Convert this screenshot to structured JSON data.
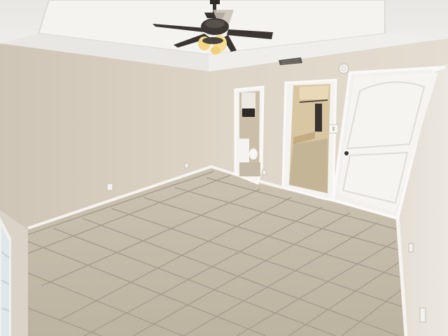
{
  "scene": {
    "kind": "empty bedroom interior photo",
    "elements": [
      "ceiling-fan",
      "recessed-tray-ceiling",
      "hvac-vent",
      "smoke-detector",
      "bathroom-doorway",
      "walk-in-closet-doorway",
      "closed-panel-door",
      "tile-floor",
      "window",
      "outlets",
      "light-switch"
    ]
  },
  "colors": {
    "wall_left": "#d6cdbf",
    "wall_back": "#e0d8ca",
    "wall_right": "#e6e0d6",
    "ceiling": "#eeece8",
    "tray": "#f2f1ee",
    "floor_tile": "#c2b8a6",
    "grout": "#a49a8a",
    "door": "#f5f4f1",
    "trim": "#f4f2ee",
    "fan_blade": "#3b3632",
    "light": "#f4d889"
  }
}
